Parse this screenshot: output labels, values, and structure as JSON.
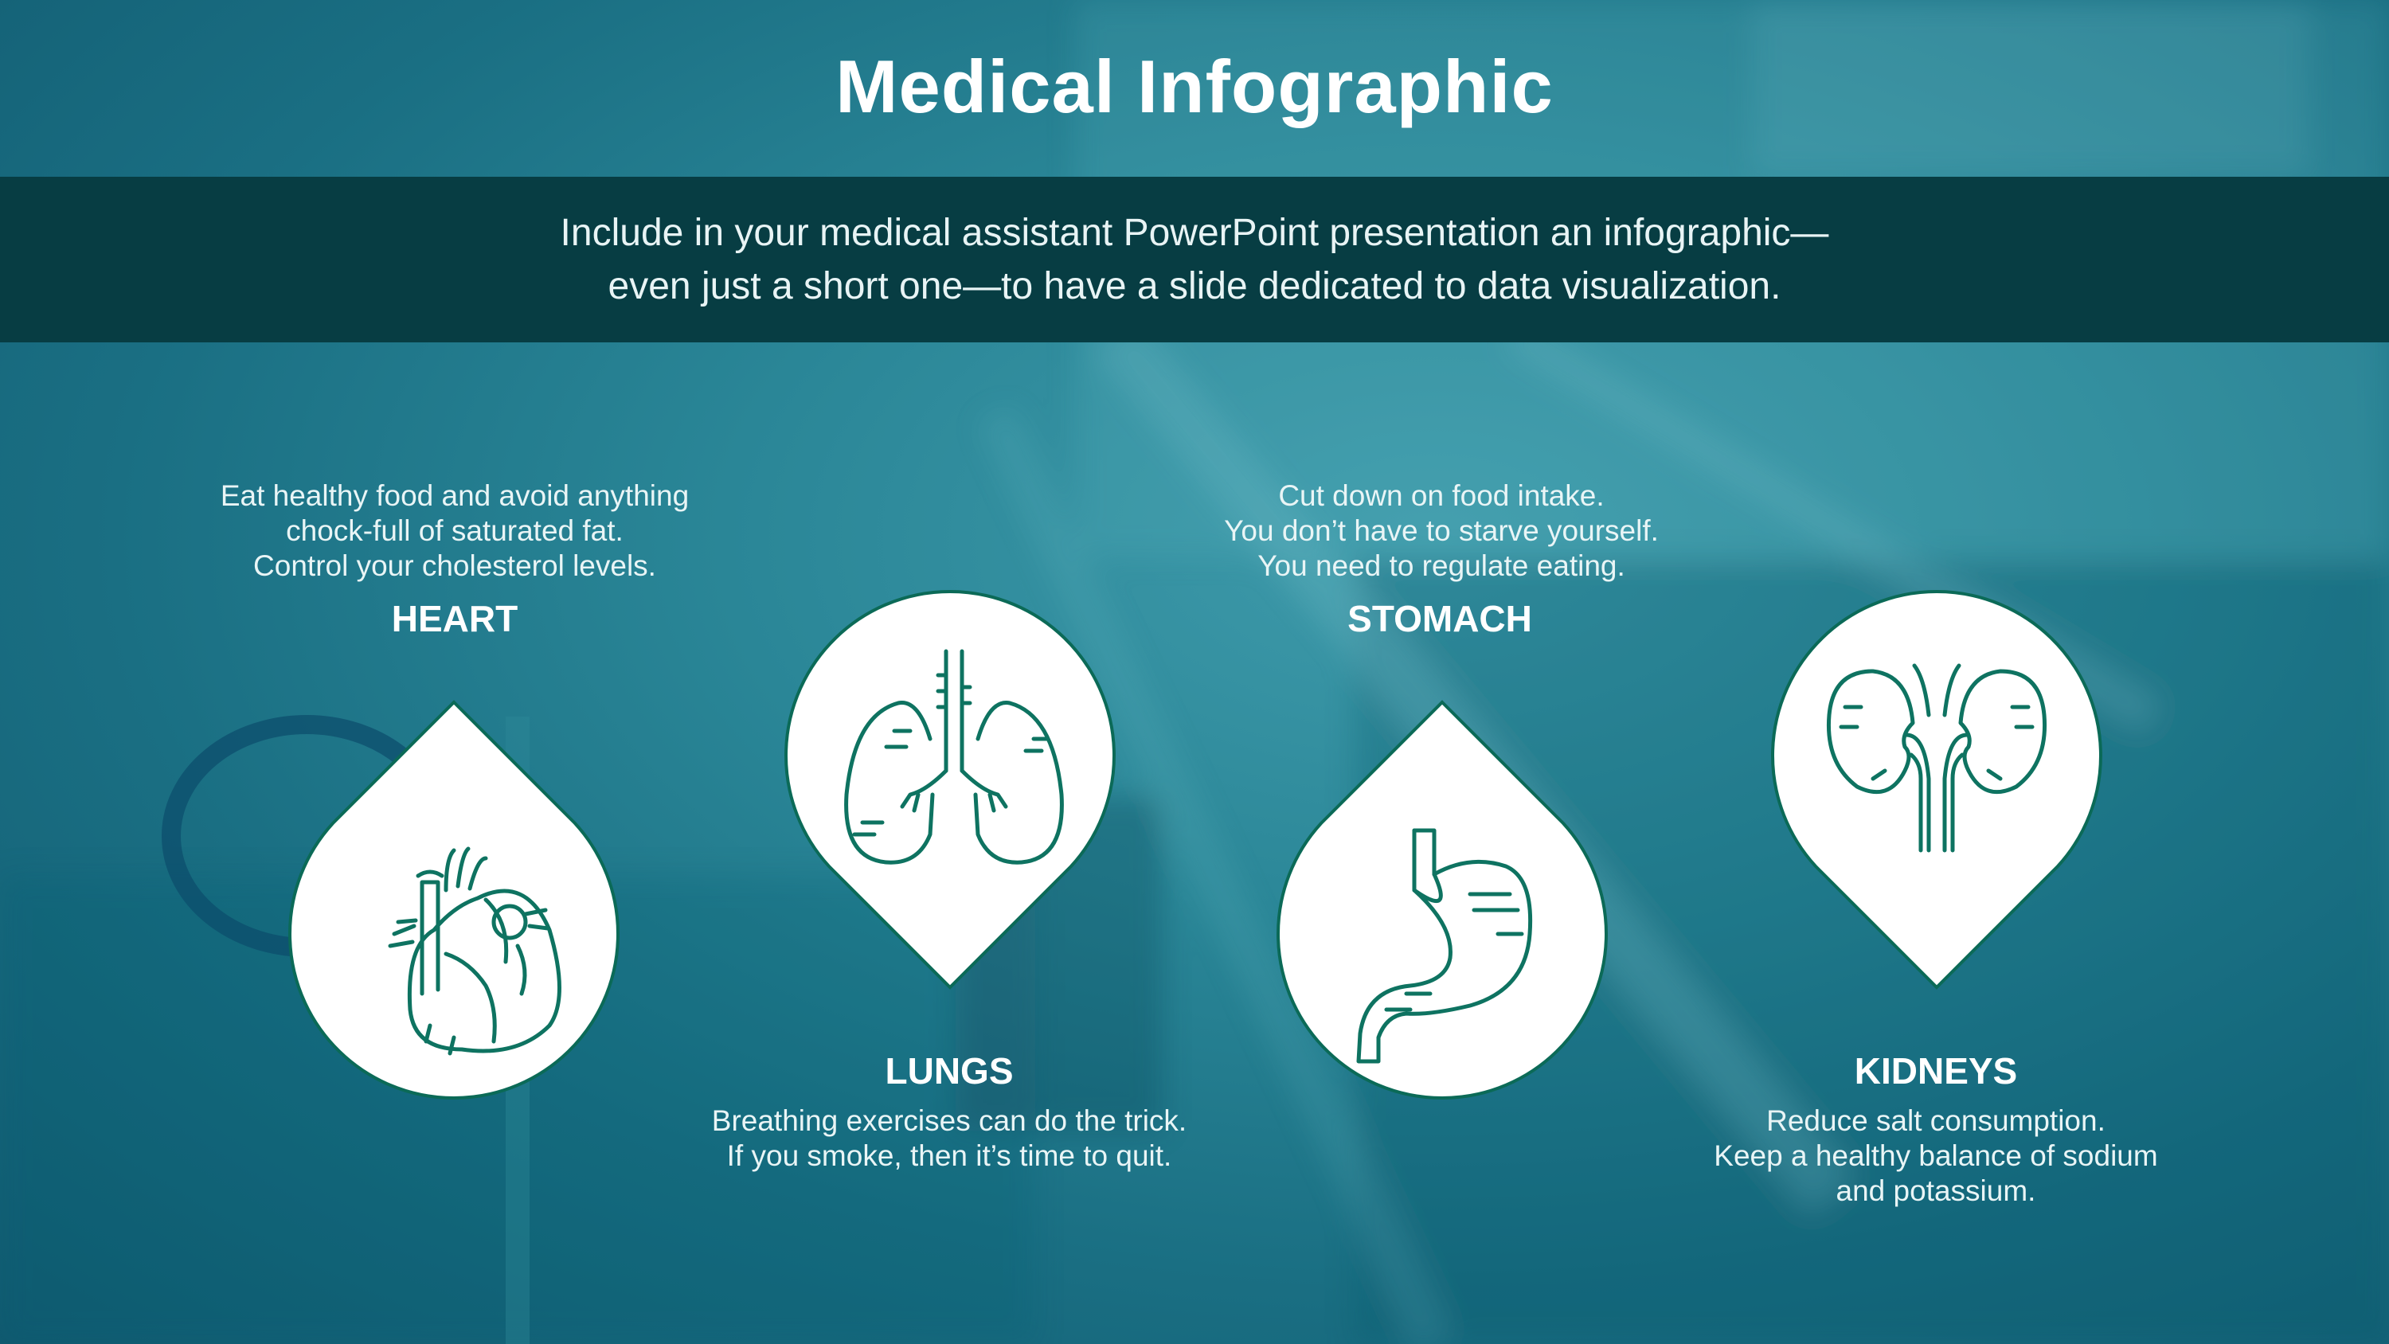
{
  "title": "Medical Infographic",
  "intro": {
    "line1": "Include in your medical assistant PowerPoint presentation an infographic—",
    "line2": "even just a short one—to have a slide dedicated to data visualization."
  },
  "colors": {
    "band": "#073d43",
    "icon_stroke": "#0e7361",
    "drop_fill": "#ffffff",
    "drop_border": "#0b6a57"
  },
  "organs": [
    {
      "name": "HEART",
      "icon": "heart-organ-icon",
      "description": [
        "Eat healthy food and avoid anything",
        "chock-full of saturated fat.",
        "Control your cholesterol levels."
      ]
    },
    {
      "name": "LUNGS",
      "icon": "lungs-icon",
      "description": [
        "Breathing exercises can do the trick.",
        "If you smoke, then it’s time to quit."
      ]
    },
    {
      "name": "STOMACH",
      "icon": "stomach-icon",
      "description": [
        "Cut down on food intake.",
        "You don’t have to starve yourself.",
        "You need to regulate eating."
      ]
    },
    {
      "name": "KIDNEYS",
      "icon": "kidneys-icon",
      "description": [
        "Reduce salt consumption.",
        "Keep a healthy balance of sodium",
        "and potassium."
      ]
    }
  ]
}
